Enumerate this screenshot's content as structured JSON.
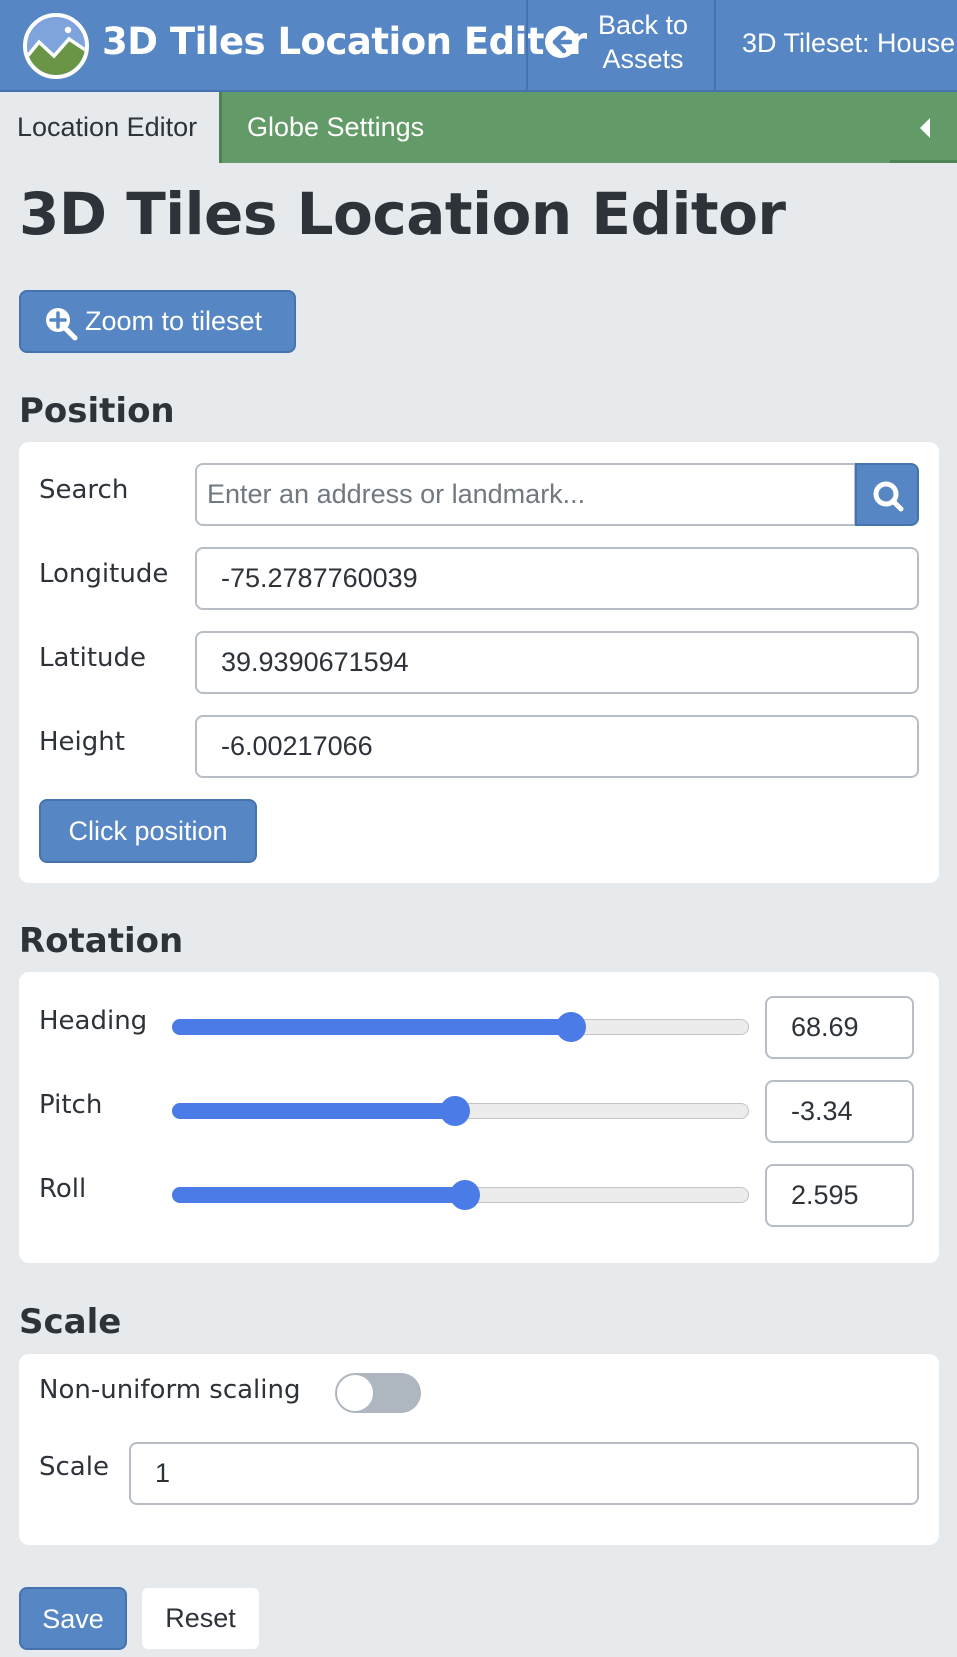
{
  "header": {
    "app_title": "3D Tiles Location Editor",
    "back_label_line1": "Back to",
    "back_label_line2": "Assets",
    "tileset_tab": "3D Tileset: House",
    "logo_icon": "cesium-logo-icon",
    "back_icon": "arrow-circle-left-icon"
  },
  "tabs": {
    "active": "Location Editor",
    "globe": "Globe Settings",
    "collapse_icon": "triangle-left-icon"
  },
  "page": {
    "title": "3D Tiles Location Editor",
    "zoom_button": "Zoom to tileset",
    "zoom_icon": "zoom-in-icon"
  },
  "position": {
    "heading": "Position",
    "search_label": "Search",
    "search_placeholder": "Enter an address or landmark...",
    "search_value": "",
    "longitude_label": "Longitude",
    "longitude": "-75.2787760039",
    "latitude_label": "Latitude",
    "latitude": "39.9390671594",
    "height_label": "Height",
    "height": "-6.00217066",
    "click_button": "Click position"
  },
  "rotation": {
    "heading": "Rotation",
    "range": [
      -180,
      180
    ],
    "items": [
      {
        "label": "Heading",
        "value": "68.69",
        "numeric": 68.69
      },
      {
        "label": "Pitch",
        "value": "-3.34",
        "numeric": -3.34
      },
      {
        "label": "Roll",
        "value": "2.595",
        "numeric": 2.595
      }
    ]
  },
  "scale": {
    "heading": "Scale",
    "nonuniform_label": "Non-uniform scaling",
    "nonuniform_on": false,
    "scale_label": "Scale",
    "scale_value": "1"
  },
  "actions": {
    "save": "Save",
    "reset": "Reset"
  },
  "colors": {
    "header_blue": "#5686c3",
    "tab_green": "#629a68",
    "slider_blue": "#4a7be6",
    "background": "#e7eaed"
  }
}
